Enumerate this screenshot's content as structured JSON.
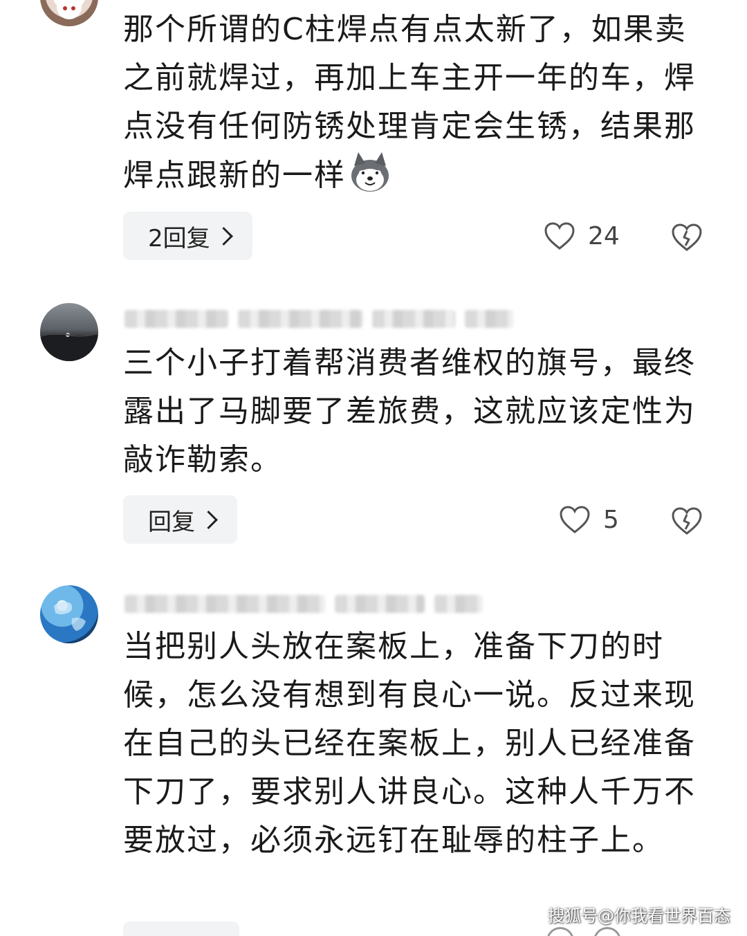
{
  "comments": [
    {
      "text": "那个所谓的C柱焊点有点太新了，如果卖之前就焊过，再加上车主开一年的车，焊点没有任何防锈处理肯定会生锈，结果那焊点跟新的一样",
      "emoji": "husky-dog-emoji",
      "reply_label": "2回复",
      "likes": "24"
    },
    {
      "text": "三个小子打着帮消费者维权的旗号，最终露出了马脚要了差旅费，这就应该定性为敲诈勒索。",
      "reply_label": "回复",
      "likes": "5"
    },
    {
      "text": "当把别人头放在案板上，准备下刀的时候，怎么没有想到有良心一说。反过来现在自己的头已经在案板上，别人已经准备下刀了，要求别人讲良心。这种人千万不要放过，必须永远钉在耻辱的柱子上。"
    }
  ],
  "watermark": "搜狐号@你我看世界百态",
  "colors": {
    "text": "#1a1a1a",
    "reply_bg": "#f2f3f4",
    "icon": "#555555"
  }
}
